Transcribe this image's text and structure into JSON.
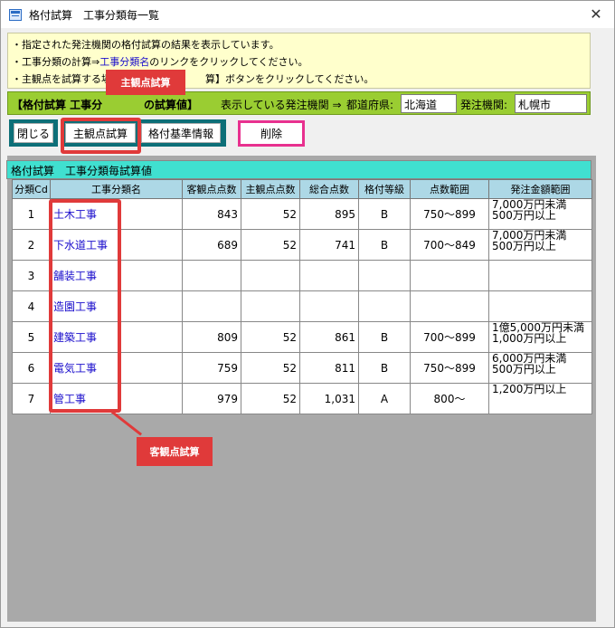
{
  "window": {
    "title": "格付試算　工事分類毎一覧",
    "close_glyph": "✕"
  },
  "info": {
    "line1": "・指定された発注機関の格付試算の結果を表示しています。",
    "line2_pre": "・工事分類の計算⇒",
    "line2_link": "工事分類名",
    "line2_post": "のリンクをクリックしてください。",
    "line3_pre": "・主観点を試算する場合",
    "line3_post": "算】ボタンをクリックしてください。"
  },
  "header": {
    "title": "【格付試算 工事分",
    "title_tail": "の試算値】",
    "display_label": "表示している発注機関 ⇒",
    "pref_label": "都道府県:",
    "pref_value": "北海道",
    "agency_label": "発注機関:",
    "agency_value": "札幌市"
  },
  "buttons": {
    "close": "閉じる",
    "subjective": "主観点試算",
    "grading_info": "格付基準情報",
    "delete": "削除"
  },
  "grid": {
    "caption": "格付試算　工事分類毎試算値",
    "columns": [
      "分類Cd",
      "工事分類名",
      "客観点点数",
      "主観点点数",
      "総合点数",
      "格付等級",
      "点数範囲",
      "発注金額範囲"
    ],
    "rows": [
      {
        "cd": "1",
        "name": "土木工事",
        "obj": "843",
        "subj": "52",
        "total": "895",
        "grade": "B",
        "range": "750～899",
        "amount1": "7,000万円未満",
        "amount2": "500万円以上"
      },
      {
        "cd": "2",
        "name": "下水道工事",
        "obj": "689",
        "subj": "52",
        "total": "741",
        "grade": "B",
        "range": "700～849",
        "amount1": "7,000万円未満",
        "amount2": "500万円以上"
      },
      {
        "cd": "3",
        "name": "舗装工事",
        "obj": "",
        "subj": "",
        "total": "",
        "grade": "",
        "range": "",
        "amount1": "",
        "amount2": ""
      },
      {
        "cd": "4",
        "name": "造園工事",
        "obj": "",
        "subj": "",
        "total": "",
        "grade": "",
        "range": "",
        "amount1": "",
        "amount2": ""
      },
      {
        "cd": "5",
        "name": "建築工事",
        "obj": "809",
        "subj": "52",
        "total": "861",
        "grade": "B",
        "range": "700～899",
        "amount1": "1億5,000万円未満",
        "amount2": "1,000万円以上"
      },
      {
        "cd": "6",
        "name": "電気工事",
        "obj": "759",
        "subj": "52",
        "total": "811",
        "grade": "B",
        "range": "750～899",
        "amount1": "6,000万円未満",
        "amount2": "500万円以上"
      },
      {
        "cd": "7",
        "name": "管工事",
        "obj": "979",
        "subj": "52",
        "total": "1,031",
        "grade": "A",
        "range": "800～",
        "amount1": "1,200万円以上",
        "amount2": ""
      }
    ]
  },
  "annotations": {
    "subjective_callout": "主観点試算",
    "objective_callout": "客観点試算"
  },
  "colors": {
    "info_bg": "#ffffcc",
    "header_bg": "#9acd32",
    "caption_bg": "#40e0d0",
    "column_header_bg": "#add8e6",
    "link": "#1a0dcc",
    "callout_red": "#e03a3a",
    "delete_frame": "#e8318f",
    "button_frame": "#0d6f78"
  }
}
